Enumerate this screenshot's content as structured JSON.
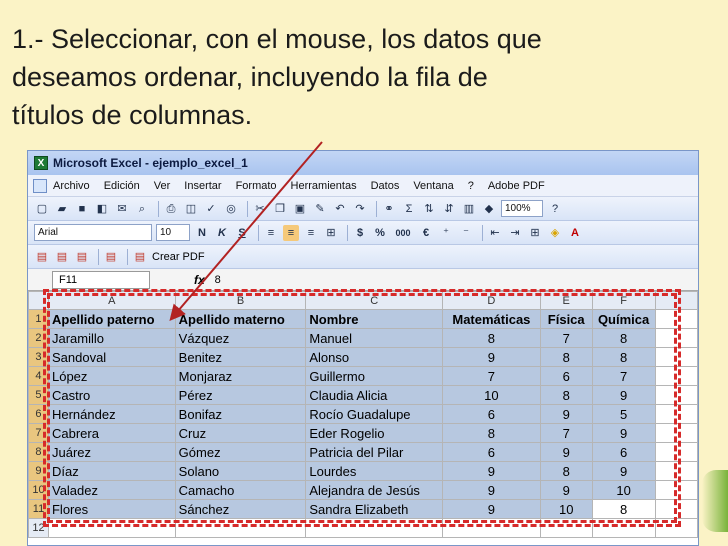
{
  "instruction": {
    "line1": "1.- Seleccionar, con el mouse, los datos que",
    "line2": "deseamos ordenar, incluyendo la fila de",
    "line3": "títulos de columnas."
  },
  "window": {
    "title": "Microsoft Excel - ejemplo_excel_1",
    "icon_label": "X"
  },
  "menu": [
    "Archivo",
    "Edición",
    "Ver",
    "Insertar",
    "Formato",
    "Herramientas",
    "Datos",
    "Ventana",
    "?",
    "Adobe PDF"
  ],
  "toolbar_std": {
    "zoom": "100%"
  },
  "toolbar_fmt": {
    "font": "Arial",
    "size": "10",
    "bold": "N",
    "italic": "K",
    "underline": "S",
    "currency": "$",
    "percent": "%",
    "thousands": "000",
    "euro": "€"
  },
  "pdf_bar": {
    "crear_pdf": "Crear PDF"
  },
  "formula_bar": {
    "cell": "F11",
    "fx": "fx",
    "value": "8"
  },
  "columns": [
    "A",
    "B",
    "C",
    "D",
    "E",
    "F"
  ],
  "headers": [
    "Apellido paterno",
    "Apellido materno",
    "Nombre",
    "Matemáticas",
    "Física",
    "Química"
  ],
  "rows": [
    [
      "Jaramillo",
      "Vázquez",
      "Manuel",
      "8",
      "7",
      "8"
    ],
    [
      "Sandoval",
      "Benitez",
      "Alonso",
      "9",
      "8",
      "8"
    ],
    [
      "López",
      "Monjaraz",
      "Guillermo",
      "7",
      "6",
      "7"
    ],
    [
      "Castro",
      "Pérez",
      "Claudia Alicia",
      "10",
      "8",
      "9"
    ],
    [
      "Hernández",
      "Bonifaz",
      "Rocío Guadalupe",
      "6",
      "9",
      "5"
    ],
    [
      "Cabrera",
      "Cruz",
      "Eder Rogelio",
      "8",
      "7",
      "9"
    ],
    [
      "Juárez",
      "Gómez",
      "Patricia del Pilar",
      "6",
      "9",
      "6"
    ],
    [
      "Díaz",
      "Solano",
      "Lourdes",
      "9",
      "8",
      "9"
    ],
    [
      "Valadez",
      "Camacho",
      "Alejandra de Jesús",
      "9",
      "9",
      "10"
    ],
    [
      "Flores",
      "Sánchez",
      "Sandra Elizabeth",
      "9",
      "10",
      "8"
    ]
  ],
  "row_numbers": [
    "1",
    "2",
    "3",
    "4",
    "5",
    "6",
    "7",
    "8",
    "9",
    "10",
    "11",
    "12"
  ],
  "colors": {
    "background": "#fbf3c6",
    "selection": "#b7c8e0",
    "marker": "#d62a2a",
    "excel_green": "#1e7a35"
  }
}
